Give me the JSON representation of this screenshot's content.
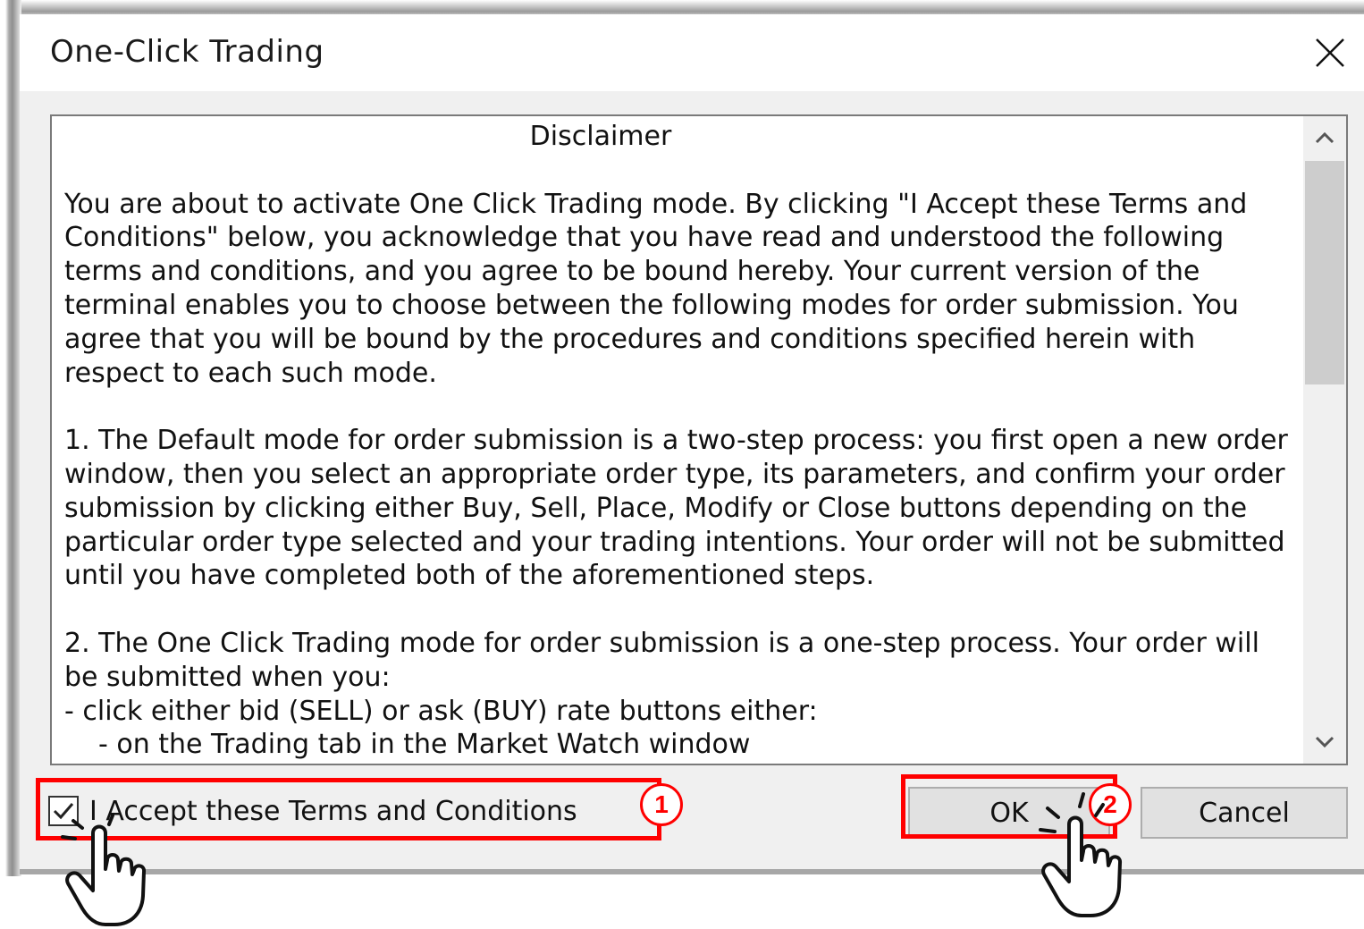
{
  "window": {
    "title": "One-Click Trading"
  },
  "disclaimer": {
    "heading": "Disclaimer",
    "paragraph1": "You are about to activate One Click Trading mode. By clicking \"I Accept these Terms and Conditions\" below, you acknowledge that you have read and understood the following terms and conditions, and you agree to be bound hereby. Your current version of the terminal enables you to choose between the following modes for order submission. You agree that you will be bound by the procedures and conditions specified herein with respect to each such mode.",
    "paragraph2": "1. The Default mode for order submission is a two-step process: you first open a new order window, then you select an appropriate order type, its parameters, and confirm your order submission by clicking either Buy, Sell, Place, Modify or Close buttons depending on the particular order type selected and your trading intentions. Your order will not be submitted until you have completed both of the aforementioned steps.",
    "paragraph3_line1": "2. The One Click Trading mode for order submission is a one-step process. Your order will be submitted when you:",
    "paragraph3_line2": "- click either bid (SELL) or ask (BUY) rate buttons either:",
    "paragraph3_line3": "- on the Trading tab in the Market Watch window"
  },
  "accept": {
    "label": "I Accept these Terms and Conditions",
    "checked": true
  },
  "buttons": {
    "ok": "OK",
    "cancel": "Cancel"
  },
  "annotations": {
    "step1": "1",
    "step2": "2",
    "highlight_color": "#ff0000"
  },
  "icons": {
    "close": "close-icon",
    "scroll_up": "chevron-up-icon",
    "scroll_down": "chevron-down-icon",
    "check": "checkmark-icon",
    "pointer": "hand-pointer-icon"
  }
}
